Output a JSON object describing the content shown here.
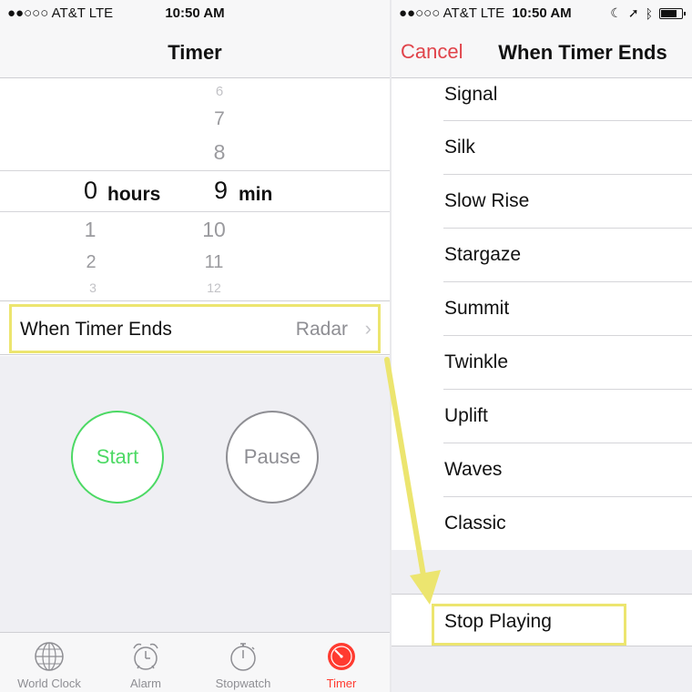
{
  "left_screen": {
    "status": {
      "carrier": "●●○○○ AT&T  LTE",
      "time": "10:50 AM"
    },
    "nav_title": "Timer",
    "picker": {
      "hours_above": [],
      "hours_selected": "0",
      "hours_label": "hours",
      "hours_below": [
        "1",
        "2",
        "3"
      ],
      "minutes_above": [
        "6",
        "7",
        "8"
      ],
      "minutes_selected": "9",
      "minutes_label": "min",
      "minutes_below": [
        "10",
        "11",
        "12"
      ]
    },
    "when_timer_ends": {
      "label": "When Timer Ends",
      "value": "Radar"
    },
    "buttons": {
      "start": "Start",
      "pause": "Pause"
    },
    "tabs": [
      {
        "label": "World Clock",
        "icon": "globe-icon"
      },
      {
        "label": "Alarm",
        "icon": "alarm-clock-icon"
      },
      {
        "label": "Stopwatch",
        "icon": "stopwatch-icon"
      },
      {
        "label": "Timer",
        "icon": "timer-icon"
      }
    ]
  },
  "right_screen": {
    "status": {
      "carrier": "●●○○○ AT&T  LTE",
      "time": "10:50 AM"
    },
    "cancel_label": "Cancel",
    "nav_title": "When Timer Ends",
    "sounds": [
      "Signal",
      "Silk",
      "Slow Rise",
      "Stargaze",
      "Summit",
      "Twinkle",
      "Uplift",
      "Waves",
      "Classic"
    ],
    "stop_playing": "Stop Playing"
  },
  "colors": {
    "accent_red": "#ff3b30",
    "start_green": "#4cd964",
    "highlight_yellow": "#ece56f",
    "cancel_red": "#e0434a"
  }
}
